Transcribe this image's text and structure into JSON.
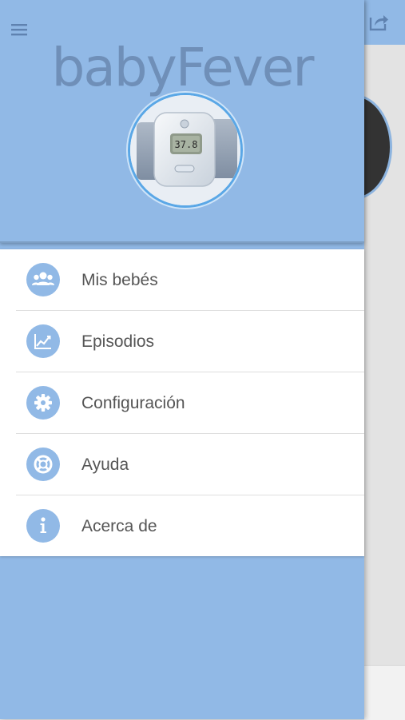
{
  "app": {
    "title": "babyFever"
  },
  "menu": {
    "items": [
      {
        "label": "Mis bebés",
        "icon": "people-icon"
      },
      {
        "label": "Episodios",
        "icon": "chart-icon"
      },
      {
        "label": "Configuración",
        "icon": "gear-icon"
      },
      {
        "label": "Ayuda",
        "icon": "lifebuoy-icon"
      },
      {
        "label": "Acerca de",
        "icon": "info-icon"
      }
    ]
  },
  "device": {
    "display_reading": "37.8"
  },
  "colors": {
    "primary": "#91b9e6",
    "title": "#6f8fb8",
    "accent_ring": "#5aa7e6"
  }
}
